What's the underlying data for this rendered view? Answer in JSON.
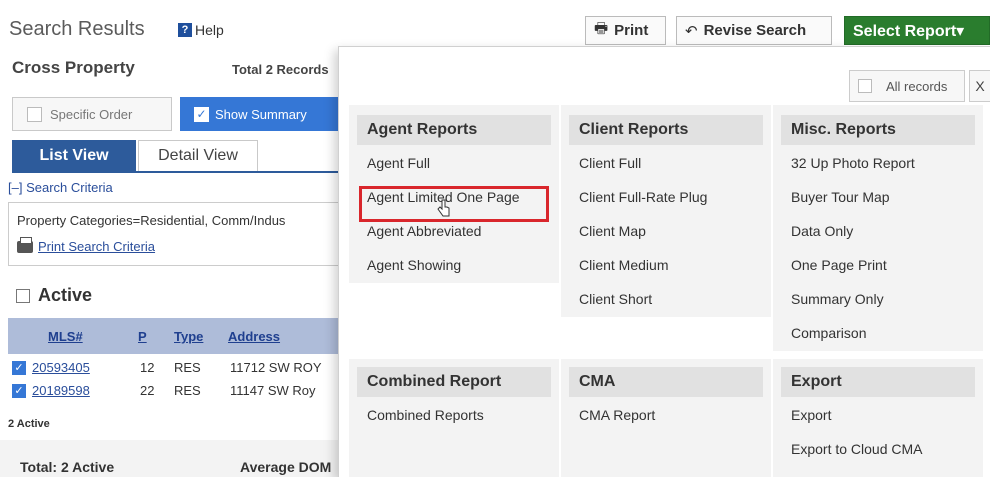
{
  "header": {
    "title": "Search Results",
    "help_label": "Help",
    "cross_property": "Cross Property",
    "total_records": "Total 2 Records"
  },
  "toolbar": {
    "print_label": "Print",
    "revise_label": "Revise Search",
    "select_report_label": "Select Report▾"
  },
  "order": {
    "specific_order_label": "Specific Order",
    "show_summary_label": "Show Summary"
  },
  "tabs": [
    {
      "label": "List View",
      "active": true
    },
    {
      "label": "Detail View",
      "active": false
    }
  ],
  "criteria": {
    "toggle_label": "[–] Search Criteria",
    "text": "Property Categories=Residential, Comm/Indus",
    "print_link": "Print Search Criteria"
  },
  "active_section": {
    "label": "Active",
    "count_label": "2 Active"
  },
  "table": {
    "headers": [
      "MLS#",
      "P",
      "Type",
      "Address"
    ],
    "rows": [
      {
        "mls": "20593405",
        "p": "12",
        "type": "RES",
        "address": "11712 SW ROY"
      },
      {
        "mls": "20189598",
        "p": "22",
        "type": "RES",
        "address": "11147 SW Roy"
      }
    ]
  },
  "totals": {
    "total_label": "Total: 2 Active",
    "average_dom_label": "Average DOM"
  },
  "dropdown": {
    "all_records_label": "All records",
    "close_label": "X",
    "agent": {
      "heading": "Agent Reports",
      "items": [
        "Agent Full",
        "Agent Limited One Page",
        "Agent Abbreviated",
        "Agent Showing"
      ]
    },
    "client": {
      "heading": "Client Reports",
      "items": [
        "Client Full",
        "Client Full-Rate Plug",
        "Client Map",
        "Client Medium",
        "Client Short"
      ]
    },
    "misc": {
      "heading": "Misc. Reports",
      "items": [
        "32 Up Photo Report",
        "Buyer Tour Map",
        "Data Only",
        "One Page Print",
        "Summary Only",
        "Comparison"
      ]
    },
    "combined": {
      "heading": "Combined Report",
      "items": [
        "Combined Reports"
      ]
    },
    "cma": {
      "heading": "CMA",
      "items": [
        "CMA Report"
      ]
    },
    "export": {
      "heading": "Export",
      "items": [
        "Export",
        "Export to Cloud CMA"
      ]
    }
  },
  "colors": {
    "select_report_green": "#2a7d2e",
    "tab_blue": "#2d5b9b",
    "summary_blue": "#3577d6",
    "highlight_red": "#d9262c",
    "table_header_bg": "#aebcd9"
  }
}
